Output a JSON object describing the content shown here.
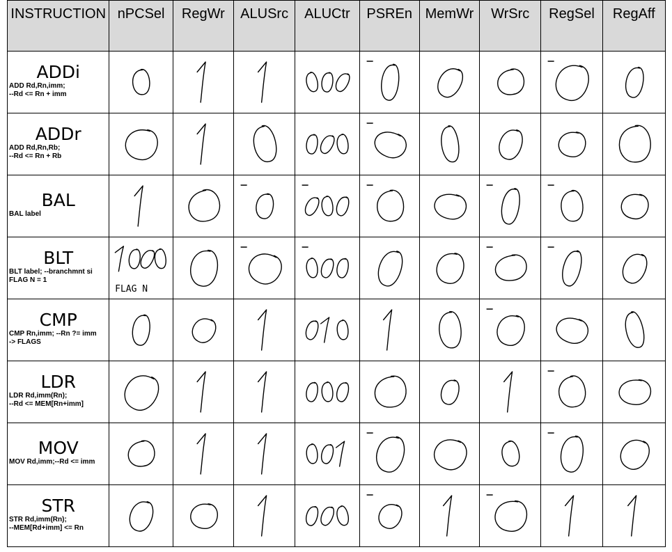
{
  "headers": [
    "INSTRUCTION",
    "nPCSel",
    "RegWr",
    "ALUSrc",
    "ALUCtr",
    "PSREn",
    "MemWr",
    "WrSrc",
    "RegSel",
    "RegAff"
  ],
  "rows": [
    {
      "name": "ADDi",
      "note": "ADD Rd,Rn,imm;\n--Rd <= Rn + imm",
      "cells": [
        {
          "value": "0"
        },
        {
          "value": "1"
        },
        {
          "value": "1"
        },
        {
          "value": "000"
        },
        {
          "value": "0",
          "bar": true
        },
        {
          "value": "0"
        },
        {
          "value": "0"
        },
        {
          "value": "0",
          "bar": true
        },
        {
          "value": "0"
        }
      ]
    },
    {
      "name": "ADDr",
      "note": "ADD Rd,Rn,Rb;\n--Rd <= Rn + Rb",
      "cells": [
        {
          "value": "0"
        },
        {
          "value": "1"
        },
        {
          "value": "0"
        },
        {
          "value": "000"
        },
        {
          "value": "0",
          "bar": true
        },
        {
          "value": "0"
        },
        {
          "value": "0"
        },
        {
          "value": "0"
        },
        {
          "value": "0"
        }
      ]
    },
    {
      "name": "BAL",
      "note": "BAL label",
      "cells": [
        {
          "value": "1"
        },
        {
          "value": "0"
        },
        {
          "value": "0",
          "bar": true
        },
        {
          "value": "000",
          "bar": true
        },
        {
          "value": "0",
          "bar": true
        },
        {
          "value": "0"
        },
        {
          "value": "0",
          "bar": true
        },
        {
          "value": "0",
          "bar": true
        },
        {
          "value": "0"
        }
      ]
    },
    {
      "name": "BLT",
      "note": "BLT label; --branchmnt si\nFLAG N = 1",
      "cells": [
        {
          "value": "1oo0",
          "sub": "FLAG N"
        },
        {
          "value": "0"
        },
        {
          "value": "0",
          "bar": true
        },
        {
          "value": "000",
          "bar": true
        },
        {
          "value": "0"
        },
        {
          "value": "0"
        },
        {
          "value": "0",
          "bar": true
        },
        {
          "value": "0",
          "bar": true
        },
        {
          "value": "0"
        }
      ]
    },
    {
      "name": "CMP",
      "note": "CMP Rn,imm; --Rn ?= imm\n-> FLAGS",
      "cells": [
        {
          "value": "0"
        },
        {
          "value": "0"
        },
        {
          "value": "1"
        },
        {
          "value": "010"
        },
        {
          "value": "1"
        },
        {
          "value": "0"
        },
        {
          "value": "0",
          "bar": true
        },
        {
          "value": "0"
        },
        {
          "value": "0"
        }
      ]
    },
    {
      "name": "LDR",
      "note": "LDR Rd,imm(Rn);\n--Rd <= MEM[Rn+imm]",
      "cells": [
        {
          "value": "0"
        },
        {
          "value": "1"
        },
        {
          "value": "1"
        },
        {
          "value": "000"
        },
        {
          "value": "0"
        },
        {
          "value": "0"
        },
        {
          "value": "1"
        },
        {
          "value": "0",
          "bar": true
        },
        {
          "value": "0"
        }
      ]
    },
    {
      "name": "MOV",
      "note": "MOV Rd,imm;--Rd <= imm",
      "cells": [
        {
          "value": "0"
        },
        {
          "value": "1"
        },
        {
          "value": "1"
        },
        {
          "value": "001"
        },
        {
          "value": "0",
          "bar": true
        },
        {
          "value": "0"
        },
        {
          "value": "0"
        },
        {
          "value": "0",
          "bar": true
        },
        {
          "value": "0"
        }
      ]
    },
    {
      "name": "STR",
      "note": "STR Rd,imm(Rn);\n--MEM[Rd+imm] <= Rn",
      "cells": [
        {
          "value": "0"
        },
        {
          "value": "0"
        },
        {
          "value": "1"
        },
        {
          "value": "000"
        },
        {
          "value": "0",
          "bar": true
        },
        {
          "value": "1"
        },
        {
          "value": "0",
          "bar": true
        },
        {
          "value": "1"
        },
        {
          "value": "1"
        }
      ]
    }
  ]
}
